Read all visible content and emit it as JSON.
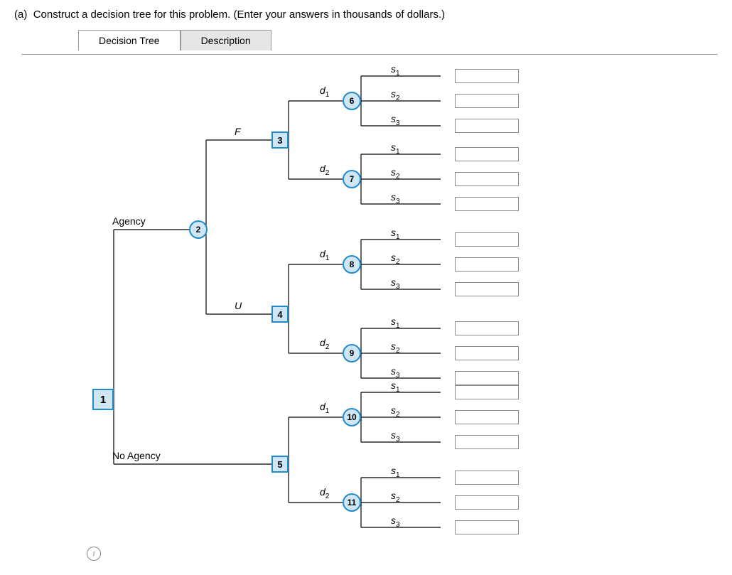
{
  "prompt": {
    "part": "a",
    "text": "Construct a decision tree for this problem. (Enter your answers in thousands of dollars.)"
  },
  "tabs": [
    "Decision Tree",
    "Description"
  ],
  "labels": {
    "agency": "Agency",
    "no_agency": "No Agency",
    "F": "F",
    "U": "U",
    "d": "d",
    "s": "s",
    "info": "i"
  },
  "nodes": {
    "n1": "1",
    "n2": "2",
    "n3": "3",
    "n4": "4",
    "n5": "5",
    "n6": "6",
    "n7": "7",
    "n8": "8",
    "n9": "9",
    "n10": "10",
    "n11": "11"
  }
}
